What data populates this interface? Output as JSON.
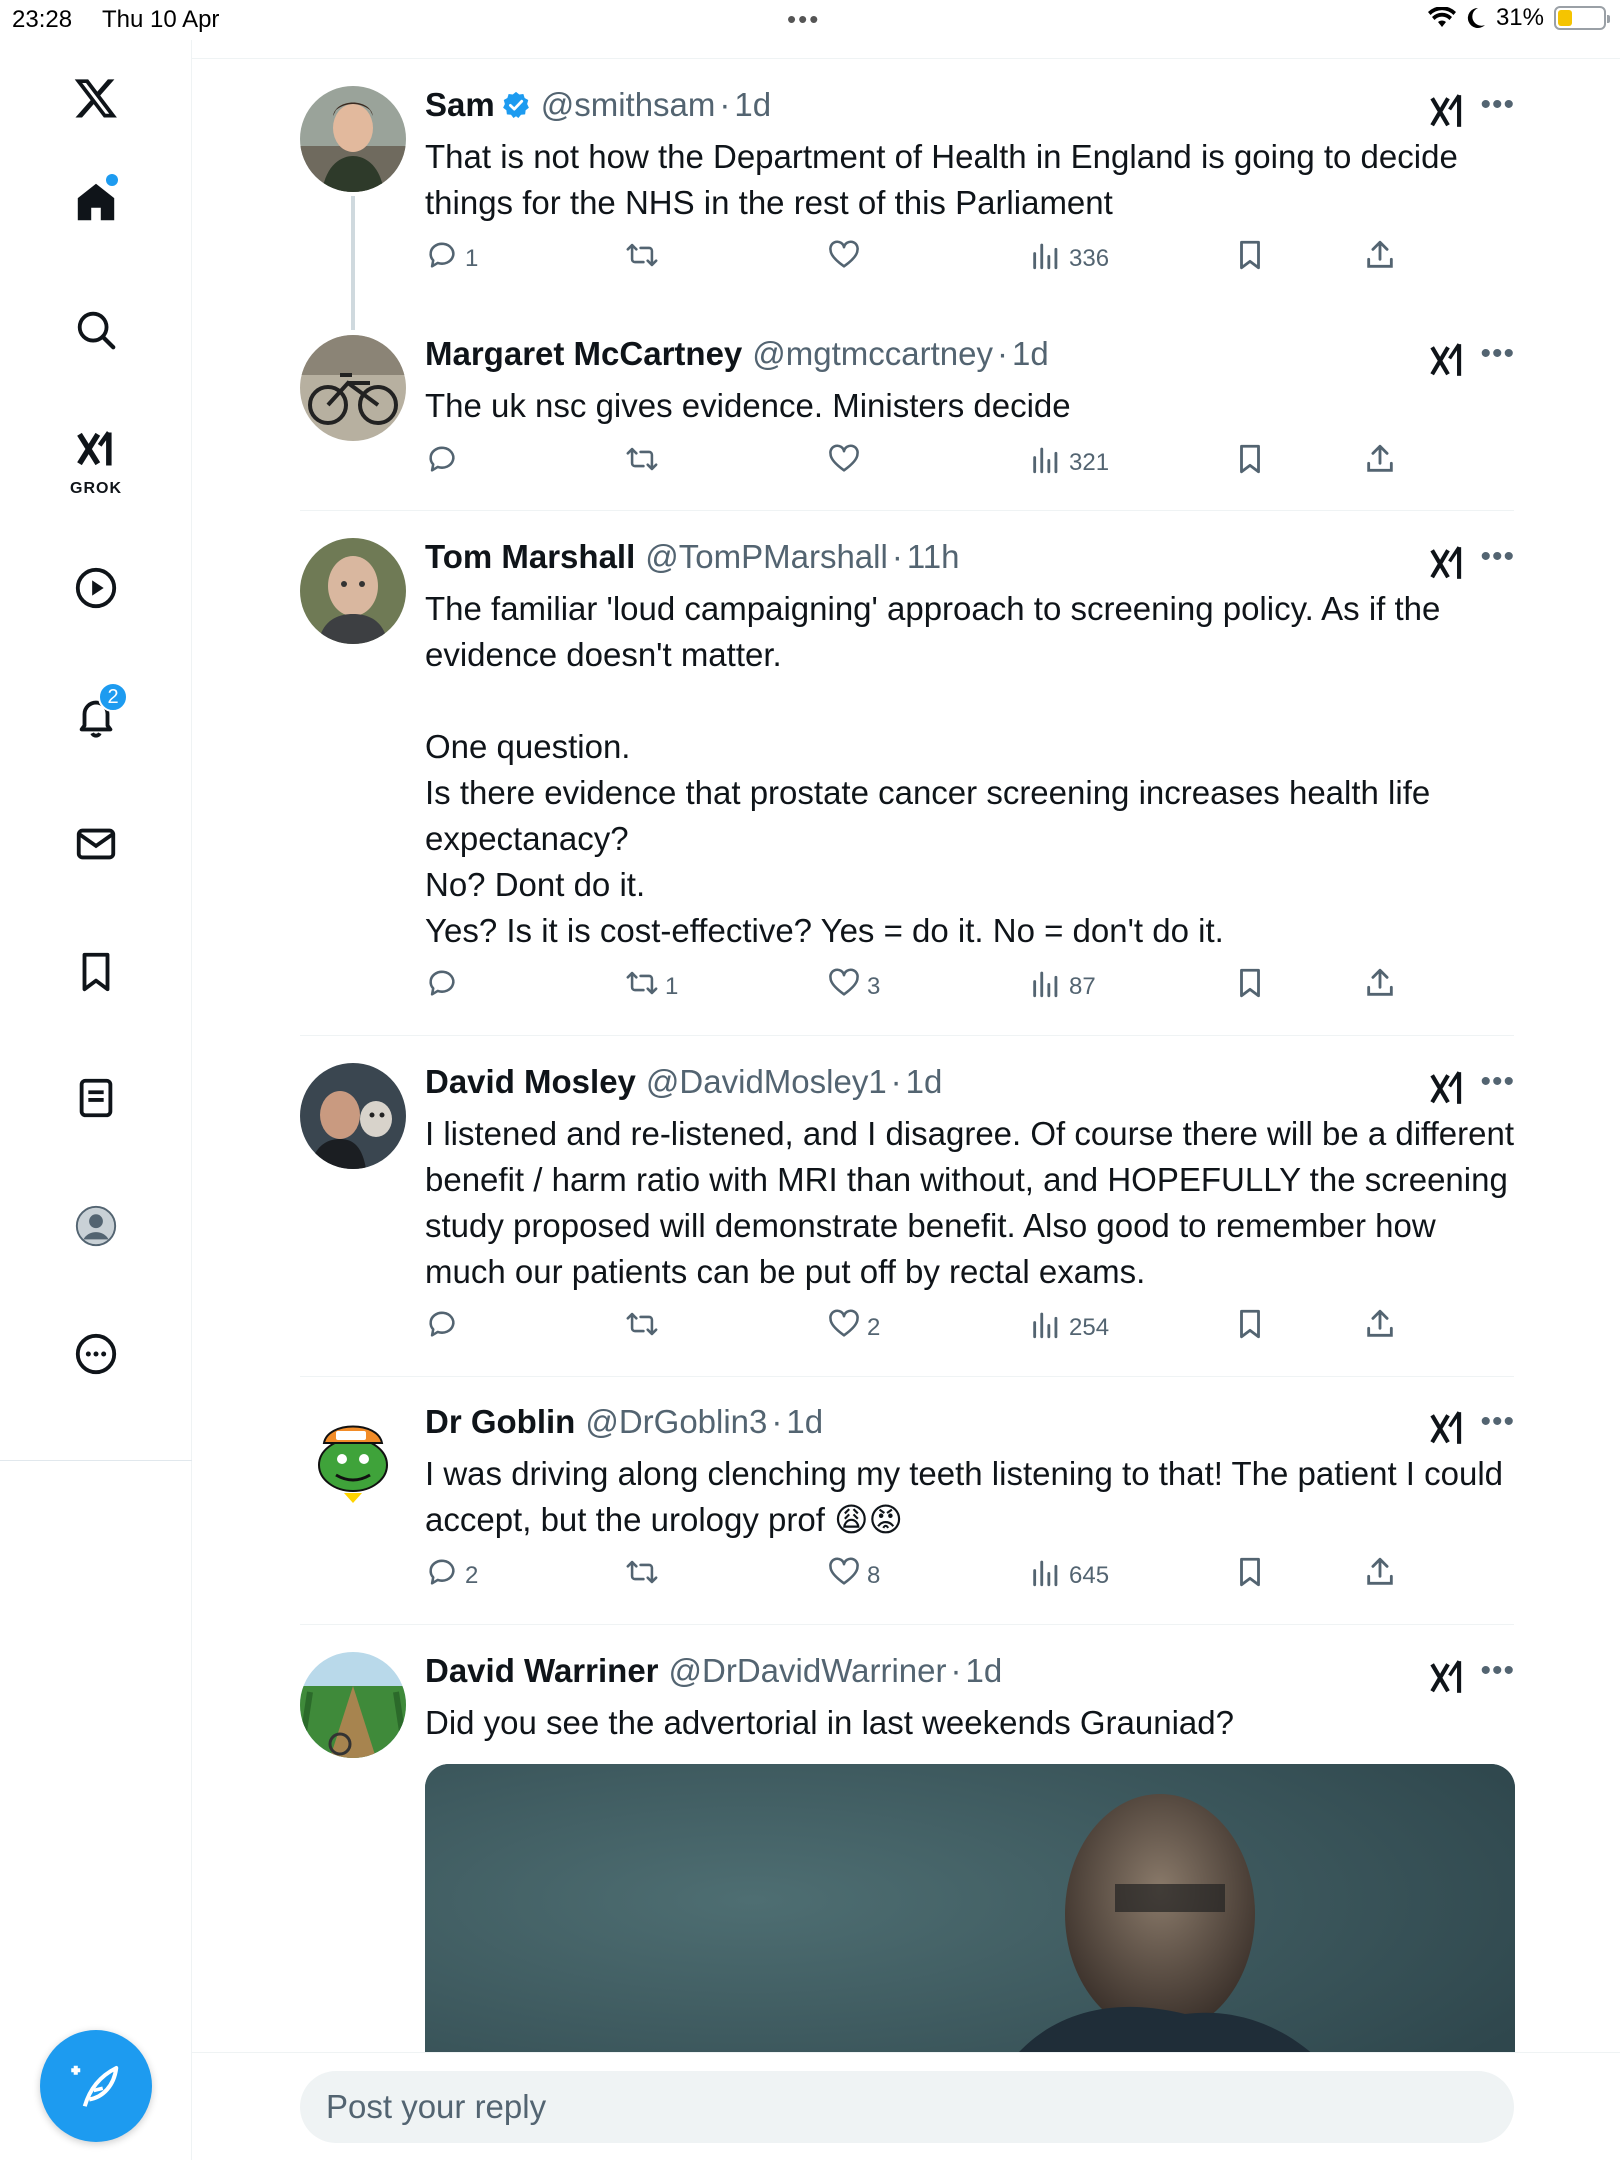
{
  "status_bar": {
    "time": "23:28",
    "date": "Thu 10 Apr",
    "battery": "31%",
    "battery_level": 0.31
  },
  "sidebar": {
    "grok_label": "GROK",
    "notifications_badge": "2"
  },
  "posts": [
    {
      "name": "Sam",
      "handle": "@smithsam",
      "time": "1d",
      "verified": true,
      "text": "That is not how the Department of Health in England is going to decide things for the NHS in the rest of this Parliament",
      "replies": "1",
      "reposts": "",
      "likes": "",
      "views": "336"
    },
    {
      "name": "Margaret McCartney",
      "handle": "@mgtmccartney",
      "time": "1d",
      "verified": false,
      "text": "The uk nsc gives evidence. Ministers decide",
      "replies": "",
      "reposts": "",
      "likes": "",
      "views": "321"
    },
    {
      "name": "Tom Marshall",
      "handle": "@TomPMarshall",
      "time": "11h",
      "verified": false,
      "text": "The familiar 'loud campaigning' approach to screening policy. As if the evidence doesn't matter.\n\nOne question.\nIs there evidence that prostate cancer screening increases health life expectanacy?\nNo? Dont do it.\nYes? Is it is cost-effective? Yes = do it. No = don't do it.",
      "replies": "",
      "reposts": "1",
      "likes": "3",
      "views": "87"
    },
    {
      "name": "David Mosley",
      "handle": "@DavidMosley1",
      "time": "1d",
      "verified": false,
      "text": "I listened and re-listened, and I disagree.  Of course there will be a different benefit / harm ratio with MRI than without, and HOPEFULLY the screening study proposed will demonstrate benefit.  Also good to remember how much our patients can be put off by rectal exams.",
      "replies": "",
      "reposts": "",
      "likes": "2",
      "views": "254"
    },
    {
      "name": "Dr Goblin",
      "handle": "@DrGoblin3",
      "time": "1d",
      "verified": false,
      "text": "I was driving along clenching my teeth listening to that! The patient I could accept, but the urology prof 😩😡",
      "replies": "2",
      "reposts": "",
      "likes": "8",
      "views": "645"
    },
    {
      "name": "David Warriner",
      "handle": "@DrDavidWarriner",
      "time": "1d",
      "verified": false,
      "text": "Did you see the advertorial in last weekends Grauniad?",
      "replies": "",
      "reposts": "",
      "likes": "",
      "views": ""
    }
  ],
  "reply_bar": {
    "placeholder": "Post your reply"
  },
  "colors": {
    "accent": "#1d9bf0",
    "text": "#0f1419",
    "muted": "#536471"
  }
}
